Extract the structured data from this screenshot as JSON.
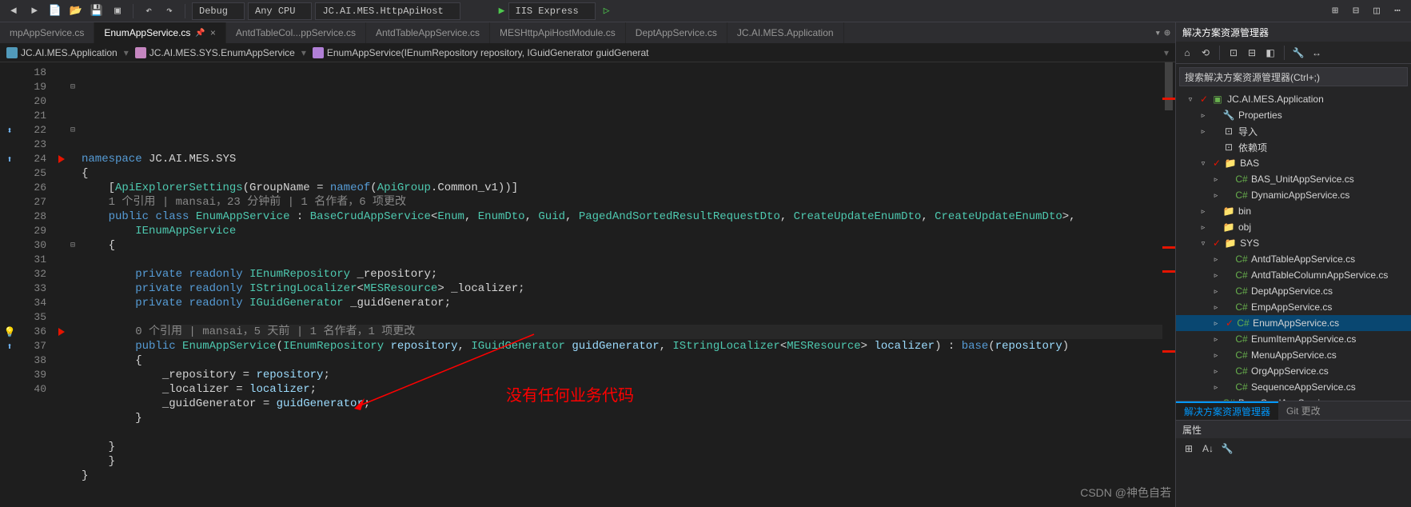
{
  "toolbar": {
    "config": "Debug",
    "platform": "Any CPU",
    "startup": "JC.AI.MES.HttpApiHost",
    "run": "IIS Express"
  },
  "tabs": [
    {
      "label": "mpAppService.cs",
      "active": false
    },
    {
      "label": "EnumAppService.cs",
      "active": true,
      "locked": true
    },
    {
      "label": "AntdTableCol...ppService.cs",
      "active": false
    },
    {
      "label": "AntdTableAppService.cs",
      "active": false
    },
    {
      "label": "MESHttpApiHostModule.cs",
      "active": false
    },
    {
      "label": "DeptAppService.cs",
      "active": false
    },
    {
      "label": "JC.AI.MES.Application",
      "active": false
    }
  ],
  "breadcrumb": {
    "project": "JC.AI.MES.Application",
    "namespace": "JC.AI.MES.SYS.EnumAppService",
    "member": "EnumAppService(IEnumRepository repository, IGuidGenerator guidGenerat"
  },
  "gutter": {
    "start": 18,
    "end": 40
  },
  "code": {
    "l19": {
      "ns": "namespace",
      "path": "JC.AI.MES.SYS"
    },
    "l21": {
      "attr": "ApiExplorerSettings",
      "prop": "GroupName",
      "nm": "nameof",
      "grp": "ApiGroup",
      "val": "Common_v1"
    },
    "codelens1": "1 个引用 | mansai，23 分钟前 | 1 名作者，6 项更改",
    "l22": {
      "pub": "public",
      "cl": "class",
      "name": "EnumAppService",
      "base": "BaseCrudAppService",
      "g1": "Enum",
      "g2": "EnumDto",
      "g3": "Guid",
      "g4": "PagedAndSortedResultRequestDto",
      "g5": "CreateUpdateEnumDto",
      "g6": "CreateUpdateEnumDto"
    },
    "l23": {
      "iface": "IEnumAppService"
    },
    "l26": {
      "pr": "private",
      "ro": "readonly",
      "type": "IEnumRepository",
      "name": "_repository"
    },
    "l27": {
      "pr": "private",
      "ro": "readonly",
      "type": "IStringLocalizer",
      "gen": "MESResource",
      "name": "_localizer"
    },
    "l28": {
      "pr": "private",
      "ro": "readonly",
      "type": "IGuidGenerator",
      "name": "_guidGenerator"
    },
    "codelens2": "0 个引用 | mansai，5 天前 | 1 名作者，1 项更改",
    "l30": {
      "pub": "public",
      "name": "EnumAppService",
      "t1": "IEnumRepository",
      "p1": "repository",
      "t2": "IGuidGenerator",
      "p2": "guidGenerator",
      "t3": "IStringLocalizer",
      "t3g": "MESResource",
      "p3": "localizer",
      "bs": "base",
      "bp": "repository"
    },
    "l32": {
      "f": "_repository",
      "v": "repository"
    },
    "l33": {
      "f": "_localizer",
      "v": "localizer"
    },
    "l34": {
      "f": "_guidGenerator",
      "v": "guidGenerator"
    }
  },
  "annotation": "没有任何业务代码",
  "solution": {
    "title": "解决方案资源管理器",
    "search_placeholder": "搜索解决方案资源管理器(Ctrl+;)",
    "tree": [
      {
        "d": 0,
        "arrow": "▿",
        "icon": "csproj",
        "label": "JC.AI.MES.Application",
        "git": true
      },
      {
        "d": 1,
        "arrow": "▹",
        "icon": "wrench",
        "label": "Properties"
      },
      {
        "d": 1,
        "arrow": "▹",
        "icon": "ref",
        "label": "导入"
      },
      {
        "d": 1,
        "arrow": "",
        "icon": "ref",
        "label": "依赖项"
      },
      {
        "d": 1,
        "arrow": "▿",
        "icon": "folder",
        "label": "BAS",
        "git": true
      },
      {
        "d": 2,
        "arrow": "▹",
        "icon": "cs",
        "label": "BAS_UnitAppService.cs"
      },
      {
        "d": 2,
        "arrow": "▹",
        "icon": "cs",
        "label": "DynamicAppService.cs"
      },
      {
        "d": 1,
        "arrow": "▹",
        "icon": "folder",
        "label": "bin"
      },
      {
        "d": 1,
        "arrow": "▹",
        "icon": "folder",
        "label": "obj"
      },
      {
        "d": 1,
        "arrow": "▿",
        "icon": "folder",
        "label": "SYS",
        "git": true
      },
      {
        "d": 2,
        "arrow": "▹",
        "icon": "cs",
        "label": "AntdTableAppService.cs"
      },
      {
        "d": 2,
        "arrow": "▹",
        "icon": "cs",
        "label": "AntdTableColumnAppService.cs"
      },
      {
        "d": 2,
        "arrow": "▹",
        "icon": "cs",
        "label": "DeptAppService.cs"
      },
      {
        "d": 2,
        "arrow": "▹",
        "icon": "cs",
        "label": "EmpAppService.cs"
      },
      {
        "d": 2,
        "arrow": "▹",
        "icon": "cs",
        "label": "EnumAppService.cs",
        "selected": true,
        "git": true
      },
      {
        "d": 2,
        "arrow": "▹",
        "icon": "cs",
        "label": "EnumItemAppService.cs"
      },
      {
        "d": 2,
        "arrow": "▹",
        "icon": "cs",
        "label": "MenuAppService.cs"
      },
      {
        "d": 2,
        "arrow": "▹",
        "icon": "cs",
        "label": "OrgAppService.cs"
      },
      {
        "d": 2,
        "arrow": "▹",
        "icon": "cs",
        "label": "SequenceAppService.cs"
      },
      {
        "d": 1,
        "arrow": "▹",
        "icon": "cs",
        "label": "BaseCrudAppService.cs"
      }
    ],
    "bottom_tabs": [
      "解决方案资源管理器",
      "Git 更改"
    ],
    "props": "属性"
  },
  "watermark": "CSDN @神色自若"
}
